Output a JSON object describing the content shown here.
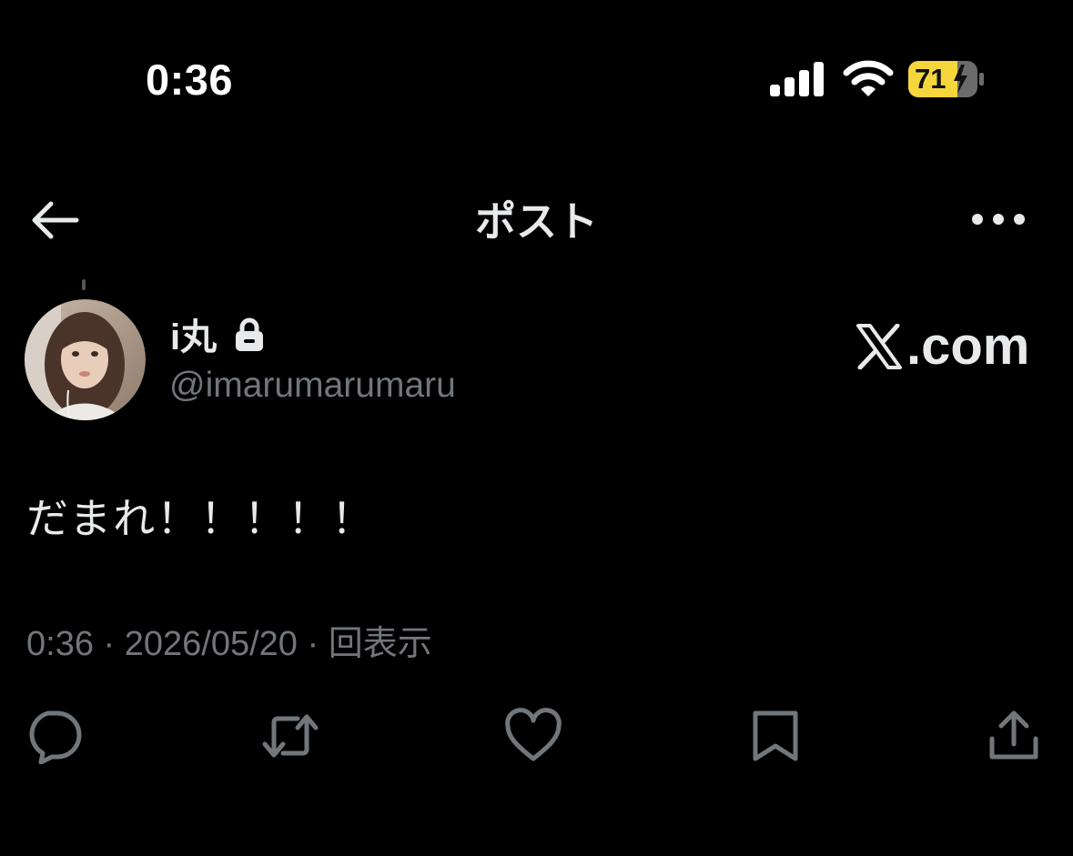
{
  "status_bar": {
    "time": "0:36",
    "battery_level": "71",
    "battery_color": "#f5d63d",
    "icons": [
      "signal-bars-icon",
      "wifi-icon",
      "battery-charging-icon"
    ]
  },
  "nav": {
    "title": "ポスト",
    "back_icon": "arrow-left-icon",
    "more_icon": "more-horizontal-icon"
  },
  "post": {
    "display_name": "i丸",
    "handle": "@imarumarumaru",
    "protected_icon": "lock-icon",
    "brand": ".com",
    "brand_icon": "x-logo-icon",
    "text": "だまれ！！！！！",
    "meta": {
      "time": "0:36",
      "separator": " · ",
      "date": "2026/05/20",
      "views_label": "回表示"
    }
  },
  "actions": [
    {
      "icon": "reply-icon"
    },
    {
      "icon": "repost-icon"
    },
    {
      "icon": "like-icon"
    },
    {
      "icon": "bookmark-icon"
    },
    {
      "icon": "share-icon"
    }
  ],
  "colors": {
    "background": "#000000",
    "primary_text": "#e7e9ea",
    "secondary_text": "#71767b"
  }
}
